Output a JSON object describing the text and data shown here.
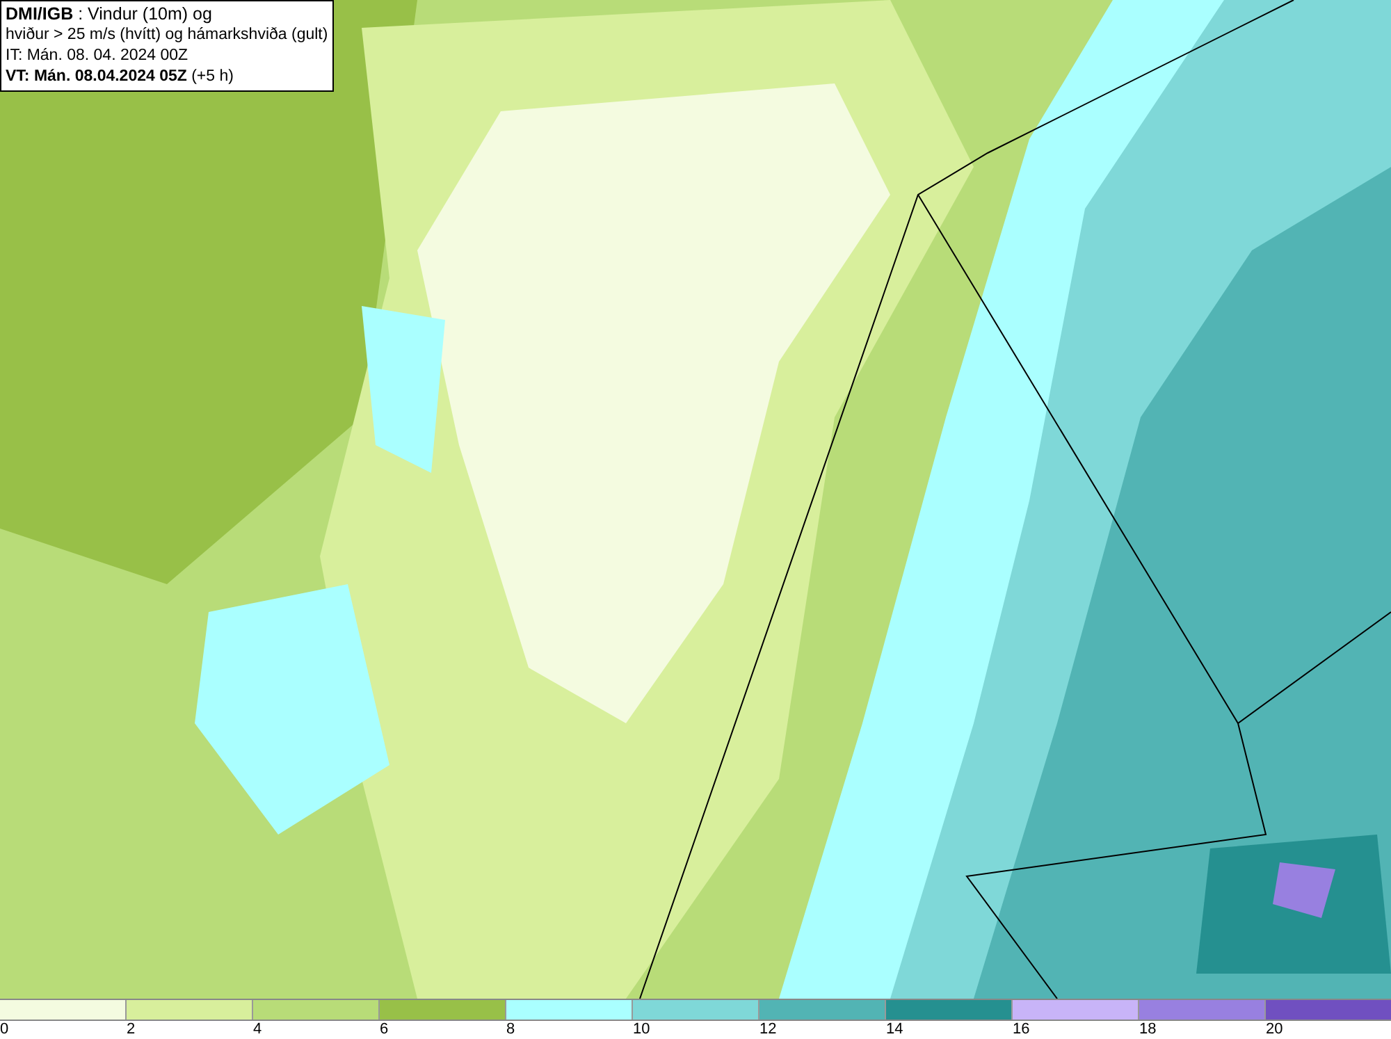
{
  "header": {
    "lines": [
      "**DMI/IGB** : Vindur (10m) og",
      "hviður > 25 m/s (hvítt) og hámarkshviða (gult)",
      "IT: Mán. 08. 04. 2024 00Z",
      "**VT: Mán. 08.04.2024 05Z** (+5 h)"
    ]
  },
  "legend": {
    "segments": [
      {
        "color": "#f4fbe0"
      },
      {
        "color": "#d8ef9c"
      },
      {
        "color": "#b8dc78"
      },
      {
        "color": "#98c048"
      },
      {
        "color": "#aaffff"
      },
      {
        "color": "#7fd8d8"
      },
      {
        "color": "#52b4b4"
      },
      {
        "color": "#259090"
      },
      {
        "color": "#c8b4f8"
      },
      {
        "color": "#9880e0"
      },
      {
        "color": "#7050c0"
      }
    ],
    "labels": [
      "0",
      "2",
      "4",
      "6",
      "8",
      "10",
      "12",
      "14",
      "16",
      "18",
      "20"
    ]
  }
}
